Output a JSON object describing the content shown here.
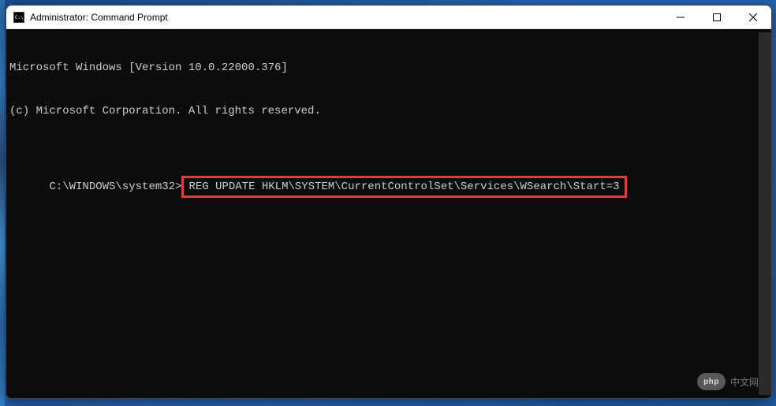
{
  "window": {
    "title": "Administrator: Command Prompt"
  },
  "console": {
    "line1": "Microsoft Windows [Version 10.0.22000.376]",
    "line2": "(c) Microsoft Corporation. All rights reserved.",
    "prompt": "C:\\WINDOWS\\system32>",
    "command": "REG UPDATE HKLM\\SYSTEM\\CurrentControlSet\\Services\\WSearch\\Start=3"
  },
  "watermark": {
    "logo": "php",
    "text": "中文网"
  }
}
